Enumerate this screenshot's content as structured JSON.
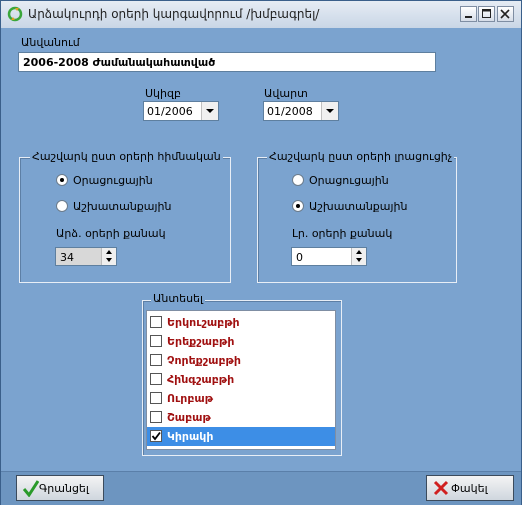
{
  "window": {
    "title": "Արձակուրդի օրերի կարգավորում /խմբագրել/",
    "controls": [
      "minimize-icon",
      "maximize-icon",
      "close-icon"
    ]
  },
  "name": {
    "label": "Անվանում",
    "value": "2006-2008 Ժամանակահատված"
  },
  "start": {
    "label": "Սկիզբ",
    "value": "01/2006"
  },
  "end": {
    "label": "Ավարտ",
    "value": "01/2008"
  },
  "group_base": {
    "title": "Հաշվարկ ըստ օրերի հիմնական",
    "option1": "Օրացուցային",
    "option2": "Աշխատանքային",
    "selected": "option1",
    "days_label": "Արձ. օրերի քանակ",
    "days_value": "34"
  },
  "group_extra": {
    "title": "Հաշվարկ ըստ օրերի լրացուցիչ",
    "option1": "Օրացուցային",
    "option2": "Աշխատանքային",
    "selected": "option2",
    "days_label": "Լր. օրերի քանակ",
    "days_value": "0"
  },
  "weekend": {
    "title": "Անտեսել",
    "items": [
      {
        "label": "Երկուշաբթի",
        "checked": false
      },
      {
        "label": "Երեքշաբթի",
        "checked": false
      },
      {
        "label": "Չորեքշաբթի",
        "checked": false
      },
      {
        "label": "Հինգշաբթի",
        "checked": false
      },
      {
        "label": "Ուրբաթ",
        "checked": false
      },
      {
        "label": "Շաբաթ",
        "checked": false
      },
      {
        "label": "Կիրակի",
        "checked": true,
        "selected": true
      }
    ]
  },
  "buttons": {
    "save": {
      "label": "Գրանցել",
      "icon": "checkmark-icon"
    },
    "close": {
      "label": "Փակել",
      "icon": "cross-icon"
    }
  },
  "colors": {
    "background": "#7ba3cf",
    "selection": "#3d8ee6",
    "item_text": "#a01010"
  }
}
